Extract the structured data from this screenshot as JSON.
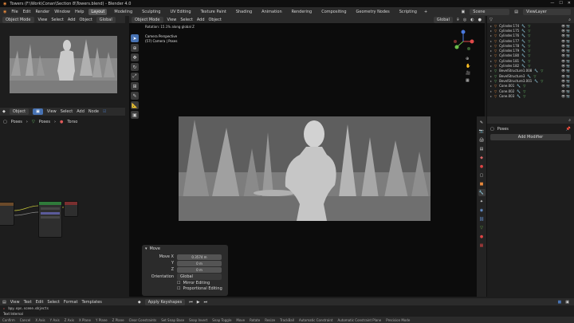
{
  "window": {
    "title": "Towers (F:\\Work\\Conan\\Section 8\\Towers.blend) - Blender 4.0"
  },
  "menu": {
    "items": [
      "File",
      "Edit",
      "Render",
      "Window",
      "Help"
    ],
    "workspaces": [
      "Layout",
      "Modeling",
      "Sculpting",
      "UV Editing",
      "Texture Paint",
      "Shading",
      "Animation",
      "Rendering",
      "Compositing",
      "Geometry Nodes",
      "Scripting"
    ],
    "scene_label": "Scene",
    "view_layer_label": "ViewLayer"
  },
  "camera_editor": {
    "mode": "Object Mode",
    "menus": [
      "View",
      "Select",
      "Add",
      "Object"
    ],
    "orientation": "Global"
  },
  "viewport": {
    "mode": "Object Mode",
    "menus": [
      "View",
      "Select",
      "Add",
      "Object"
    ],
    "orientation": "Global",
    "rotation_text": "Rotation: 15.1% along global Z",
    "overlay_title": "Camera Perspective",
    "overlay_sub": "(57) Camera | Poses"
  },
  "node_editor": {
    "mode": "Object",
    "menus": [
      "View",
      "Select",
      "Add",
      "Node"
    ],
    "use_nodes": "Use Nodes",
    "breadcrumb": [
      "Poses",
      "Poses",
      "Torso"
    ]
  },
  "redo_panel": {
    "title": "Move",
    "move_x_label": "Move X",
    "x_value": "0.3574 m",
    "y_label": "Y",
    "y_value": "0 m",
    "z_label": "Z",
    "z_value": "0 m",
    "orientation_label": "Orientation",
    "orientation_value": "Global",
    "mirror_editing": "Mirror Editing",
    "proportional_editing": "Proportional Editing"
  },
  "outliner": {
    "rows": [
      {
        "label": "Cylinder.174",
        "icon": "cyl"
      },
      {
        "label": "Cylinder.175",
        "icon": "cyl"
      },
      {
        "label": "Cylinder.176",
        "icon": "cyl"
      },
      {
        "label": "Cylinder.177",
        "icon": "cyl"
      },
      {
        "label": "Cylinder.178",
        "icon": "cyl"
      },
      {
        "label": "Cylinder.179",
        "icon": "cyl"
      },
      {
        "label": "Cylinder.180",
        "icon": "cyl"
      },
      {
        "label": "Cylinder.181",
        "icon": "cyl"
      },
      {
        "label": "Cylinder.182",
        "icon": "cyl"
      },
      {
        "label": "BevelStructure1.008",
        "icon": "arm"
      },
      {
        "label": "BevelStructure3",
        "icon": "arm"
      },
      {
        "label": "BevelStructure3.001",
        "icon": "arm"
      },
      {
        "label": "Cone.001",
        "icon": "cyl"
      },
      {
        "label": "Cone.002",
        "icon": "cyl"
      },
      {
        "label": "Cone.003",
        "icon": "cyl"
      }
    ]
  },
  "properties": {
    "object_name": "Poses",
    "add_modifier": "Add Modifier"
  },
  "timeline": {
    "menus": [
      "View",
      "Text",
      "Edit",
      "Select",
      "Format",
      "Templates"
    ],
    "apply_keyshapes": "Apply Keyshapes"
  },
  "console": {
    "line": "bpy.ops.scene.objects"
  },
  "info_text": "Text Internal",
  "status": {
    "items": [
      "Confirm",
      "Cancel",
      "X Axis",
      "Y Axis",
      "Z Axis",
      "X Plane",
      "Y Plane",
      "Z Plane",
      "Clear Constraints",
      "Set Snap Base",
      "Snap Invert",
      "Snap Toggle",
      "Move",
      "Rotate",
      "Resize",
      "TrackBall",
      "Automatic Constraint",
      "Automatic Constraint Plane",
      "Precision Mode"
    ]
  },
  "colors": {
    "accent": "#4772b3",
    "cylinder_icon": "#e7893c",
    "armature_icon": "#6fcf6f"
  }
}
